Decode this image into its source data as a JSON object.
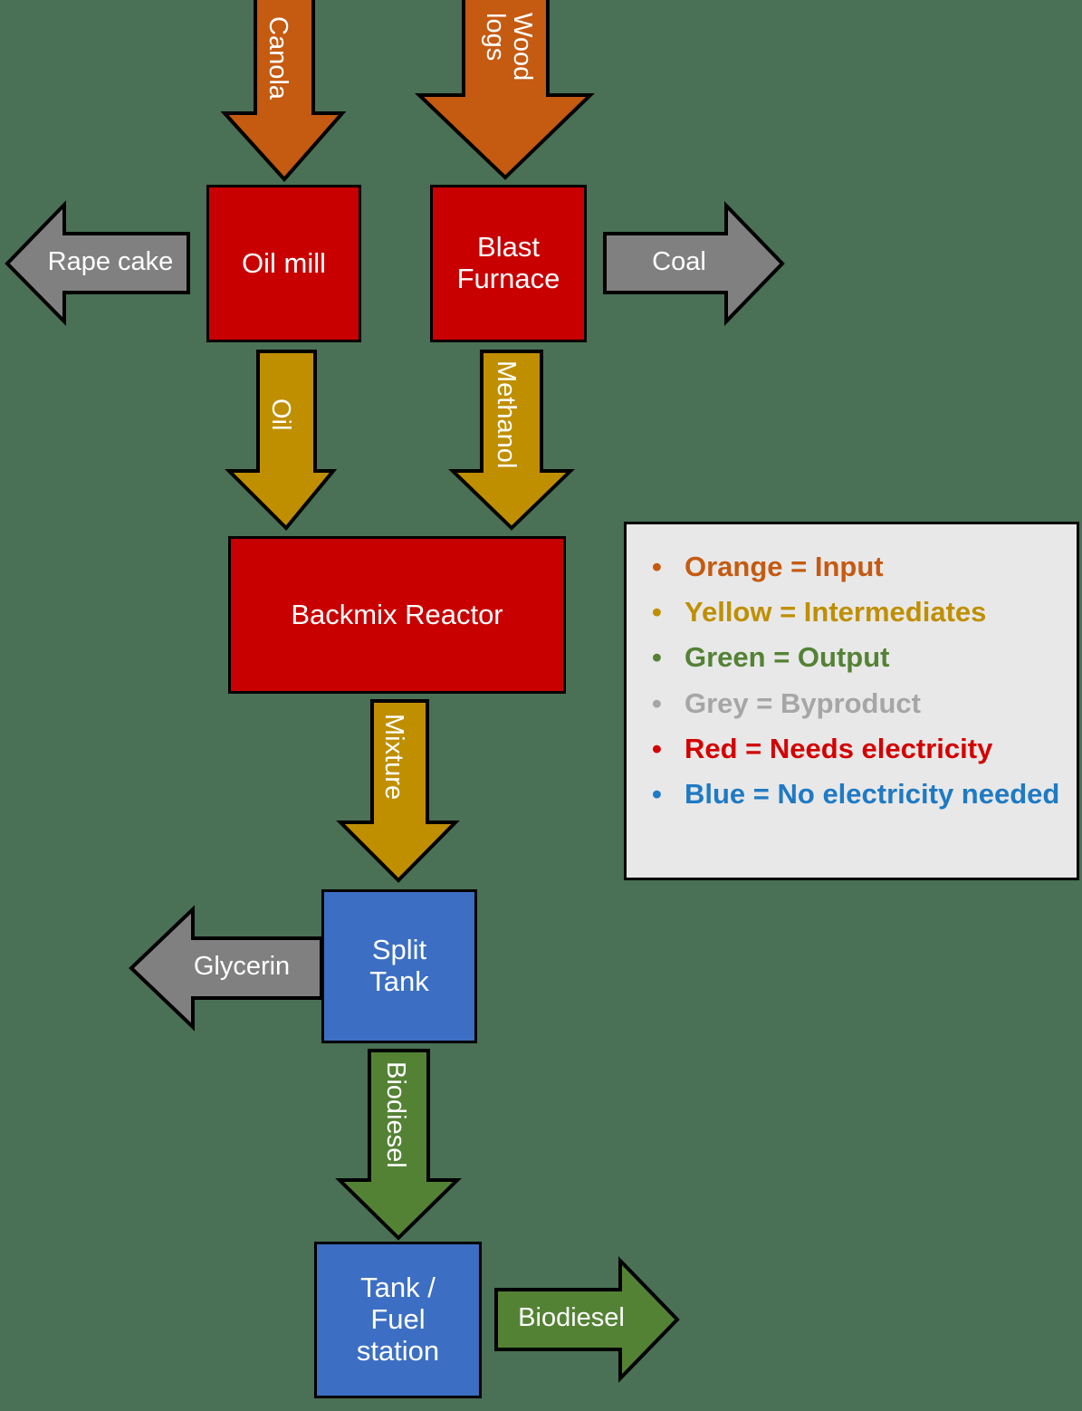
{
  "background_color": "#4a7055",
  "nodes": [
    {
      "id": "oil-mill",
      "label": "Oil mill",
      "color": "#c80000",
      "category": "red"
    },
    {
      "id": "blast-furnace",
      "label": "Blast\nFurnace",
      "color": "#c80000",
      "category": "red"
    },
    {
      "id": "backmix",
      "label": "Backmix Reactor",
      "color": "#c80000",
      "category": "red"
    },
    {
      "id": "split-tank",
      "label": "Split\nTank",
      "color": "#3c6fc3",
      "category": "blue"
    },
    {
      "id": "tank-fuel",
      "label": "Tank /\nFuel\nstation",
      "color": "#3c6fc3",
      "category": "blue"
    }
  ],
  "arrows": [
    {
      "id": "canola",
      "label": "Canola",
      "color": "#c55a11",
      "direction": "down",
      "category": "input"
    },
    {
      "id": "wood-logs",
      "label": "Wood\nlogs",
      "color": "#c55a11",
      "direction": "down",
      "category": "input"
    },
    {
      "id": "rape-cake",
      "label": "Rape cake",
      "color": "#808080",
      "direction": "left",
      "category": "byproduct"
    },
    {
      "id": "coal",
      "label": "Coal",
      "color": "#808080",
      "direction": "right",
      "category": "byproduct"
    },
    {
      "id": "oil",
      "label": "Oil",
      "color": "#bf8f00",
      "direction": "down",
      "category": "intermediate"
    },
    {
      "id": "methanol",
      "label": "Methanol",
      "color": "#bf8f00",
      "direction": "down",
      "category": "intermediate"
    },
    {
      "id": "mixture",
      "label": "Mixture",
      "color": "#bf8f00",
      "direction": "down",
      "category": "intermediate"
    },
    {
      "id": "glycerin",
      "label": "Glycerin",
      "color": "#808080",
      "direction": "left",
      "category": "byproduct"
    },
    {
      "id": "biodiesel-down",
      "label": "Biodiesel",
      "color": "#548235",
      "direction": "down",
      "category": "output"
    },
    {
      "id": "biodiesel-right",
      "label": "Biodiesel",
      "color": "#548235",
      "direction": "right",
      "category": "output"
    }
  ],
  "legend": {
    "items": [
      {
        "text": "Orange = Input",
        "color": "#c55a11"
      },
      {
        "text": "Yellow = Intermediates",
        "color": "#bf8f00"
      },
      {
        "text": "Green = Output",
        "color": "#548235"
      },
      {
        "text": "Grey = Byproduct",
        "color": "#a6a6a6"
      },
      {
        "text": "Red = Needs electricity",
        "color": "#d40000"
      },
      {
        "text": "Blue = No electricity needed",
        "color": "#1f7ac4"
      }
    ],
    "bullet": "•",
    "background": "#e8e8e8"
  }
}
